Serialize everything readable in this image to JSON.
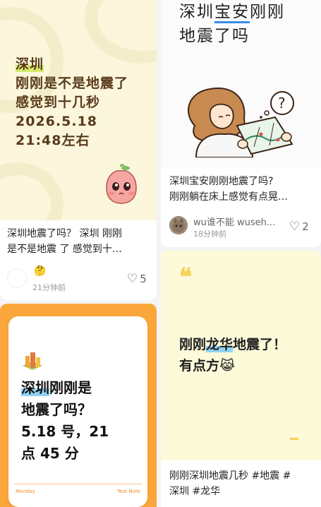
{
  "feed": {
    "card1": {
      "cover": {
        "tag": "深圳",
        "lines": [
          "刚刚是不是地震了",
          "感觉到十几秒",
          "2026.5.18",
          "21:48左右"
        ]
      },
      "title": [
        "深圳地震了吗？ 深圳 刚刚",
        "是不是地震 了 感觉到十…"
      ],
      "author_emoji": "🤔",
      "time": "21分钟前",
      "likes": "5"
    },
    "card2": {
      "cover": {
        "title_pre": "深圳",
        "title_hl": "宝安",
        "title_post": "刚刚",
        "title_line2": "地震了吗"
      },
      "title": [
        "深圳宝安刚刚地震了吗?",
        "刚刚躺在床上感觉有点晃…"
      ],
      "author": "wu谁不能 wuseh...",
      "time": "18分钟前",
      "likes": "2"
    },
    "card3": {
      "cover": {
        "hl": "深圳",
        "line1_rest": "刚刚是",
        "line2": "地震了吗？",
        "line3": "5.18 号，21",
        "line4": "点 45 分",
        "footer_left": "Monday",
        "footer_right": "Text Note"
      }
    },
    "card4": {
      "cover": {
        "quote": "❝",
        "line1_pre": "刚刚",
        "line1_hl": "龙华",
        "line1_post": "地震了！",
        "line2": "有点方😹"
      },
      "title": [
        "刚刚深圳地震几秒 #地震  #",
        "深圳 #龙华"
      ]
    }
  },
  "icons": {
    "like": "heart-outline-icon"
  },
  "colors": {
    "orange_card": "#fba63a",
    "cream": "#fbf6dc",
    "highlight_green": "#d7ea6d",
    "highlight_blue": "#8fd3f4"
  }
}
